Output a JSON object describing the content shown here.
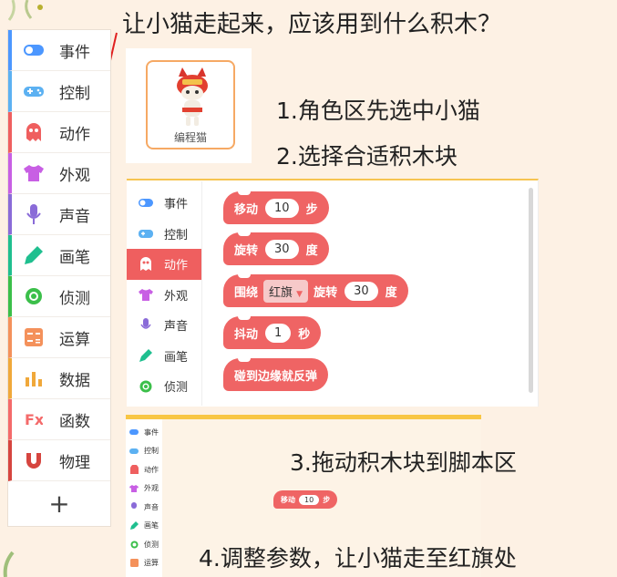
{
  "question": "让小猫走起来，应该用到什么积木？",
  "steps": [
    "1.角色区先选中小猫",
    "2.选择合适积木块",
    "3.拖动积木块到脚本区",
    "4.调整参数，让小猫走至红旗处"
  ],
  "sidebar": {
    "items": [
      {
        "label": "事件",
        "icon": "toggle-icon",
        "color": "#4c97ff"
      },
      {
        "label": "控制",
        "icon": "gamepad-icon",
        "color": "#5cb1f2"
      },
      {
        "label": "动作",
        "icon": "ghost-icon",
        "color": "#ef5f5f"
      },
      {
        "label": "外观",
        "icon": "tshirt-icon",
        "color": "#c85fe4"
      },
      {
        "label": "声音",
        "icon": "microphone-icon",
        "color": "#8a6bd8"
      },
      {
        "label": "画笔",
        "icon": "pen-icon",
        "color": "#1fbf8f"
      },
      {
        "label": "侦测",
        "icon": "target-icon",
        "color": "#3bbf4a"
      },
      {
        "label": "运算",
        "icon": "calculator-icon",
        "color": "#f4915b"
      },
      {
        "label": "数据",
        "icon": "bar-chart-icon",
        "color": "#f0a83a"
      },
      {
        "label": "函数",
        "icon": "function-icon",
        "color": "#f46a6a"
      },
      {
        "label": "物理",
        "icon": "magnet-icon",
        "color": "#d6453f"
      }
    ],
    "add_label": "+"
  },
  "sprite": {
    "name": "编程猫"
  },
  "blocks_panel": {
    "categories": [
      {
        "label": "事件",
        "icon": "toggle-icon",
        "color": "#4c97ff"
      },
      {
        "label": "控制",
        "icon": "gamepad-icon",
        "color": "#5cb1f2"
      },
      {
        "label": "动作",
        "icon": "ghost-icon",
        "color": "#ffffff"
      },
      {
        "label": "外观",
        "icon": "tshirt-icon",
        "color": "#c85fe4"
      },
      {
        "label": "声音",
        "icon": "microphone-icon",
        "color": "#8a6bd8"
      },
      {
        "label": "画笔",
        "icon": "pen-icon",
        "color": "#1fbf8f"
      },
      {
        "label": "侦测",
        "icon": "target-icon",
        "color": "#3bbf4a"
      }
    ],
    "blocks": {
      "move": {
        "label": "移动",
        "value": "10",
        "unit": "步"
      },
      "rotate": {
        "label": "旋转",
        "value": "30",
        "unit": "度"
      },
      "orbit": {
        "label": "围绕",
        "target": "红旗",
        "label2": "旋转",
        "value": "30",
        "unit": "度"
      },
      "shake": {
        "label": "抖动",
        "value": "1",
        "unit": "秒"
      },
      "bounce": {
        "label": "碰到边缘就反弹"
      }
    }
  },
  "script_area": {
    "categories": [
      "事件",
      "控制",
      "动作",
      "外观",
      "声音",
      "画笔",
      "侦测",
      "运算"
    ],
    "block": {
      "label": "移动",
      "value": "10",
      "unit": "步"
    }
  },
  "colors": {
    "accent": "#ef6464",
    "arrow": "#e02020",
    "highlight_border": "#f6a964"
  }
}
